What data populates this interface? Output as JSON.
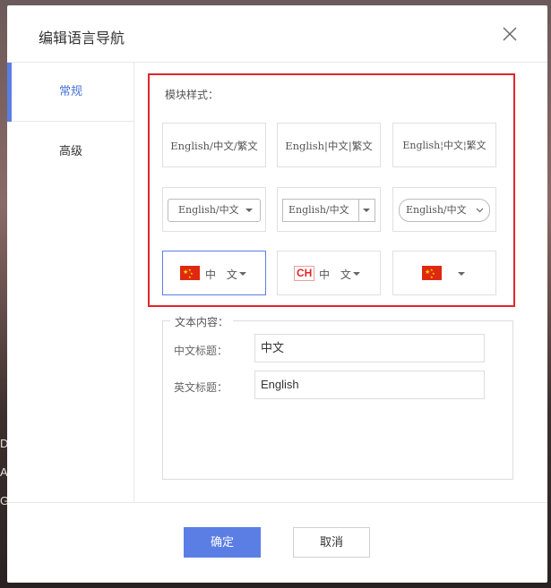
{
  "dialog": {
    "title": "编辑语言导航",
    "close_icon": "close-icon"
  },
  "sidebar": {
    "items": [
      {
        "label": "常规",
        "active": true
      },
      {
        "label": "高级",
        "active": false
      }
    ]
  },
  "module_style": {
    "label": "模块样式：",
    "options": [
      {
        "text": "English/中文/繁文"
      },
      {
        "text": "English|中文|繁文"
      },
      {
        "text": "English¦中文¦繁文"
      },
      {
        "text": "English/中文"
      },
      {
        "text": "English/中文"
      },
      {
        "text": "English/中文"
      },
      {
        "text": "中 文",
        "flag": "china-flag-icon",
        "selected": true
      },
      {
        "badge": "CH",
        "text": "中 文"
      },
      {
        "flag": "china-flag-icon"
      }
    ]
  },
  "text_content": {
    "legend": "文本内容：",
    "chinese_title_label": "中文标题：",
    "chinese_title_value": "中文",
    "english_title_label": "英文标题：",
    "english_title_value": "English"
  },
  "footer": {
    "ok_label": "确定",
    "cancel_label": "取消"
  },
  "colors": {
    "accent": "#5b7ee5",
    "highlight_border": "#e0262c"
  }
}
